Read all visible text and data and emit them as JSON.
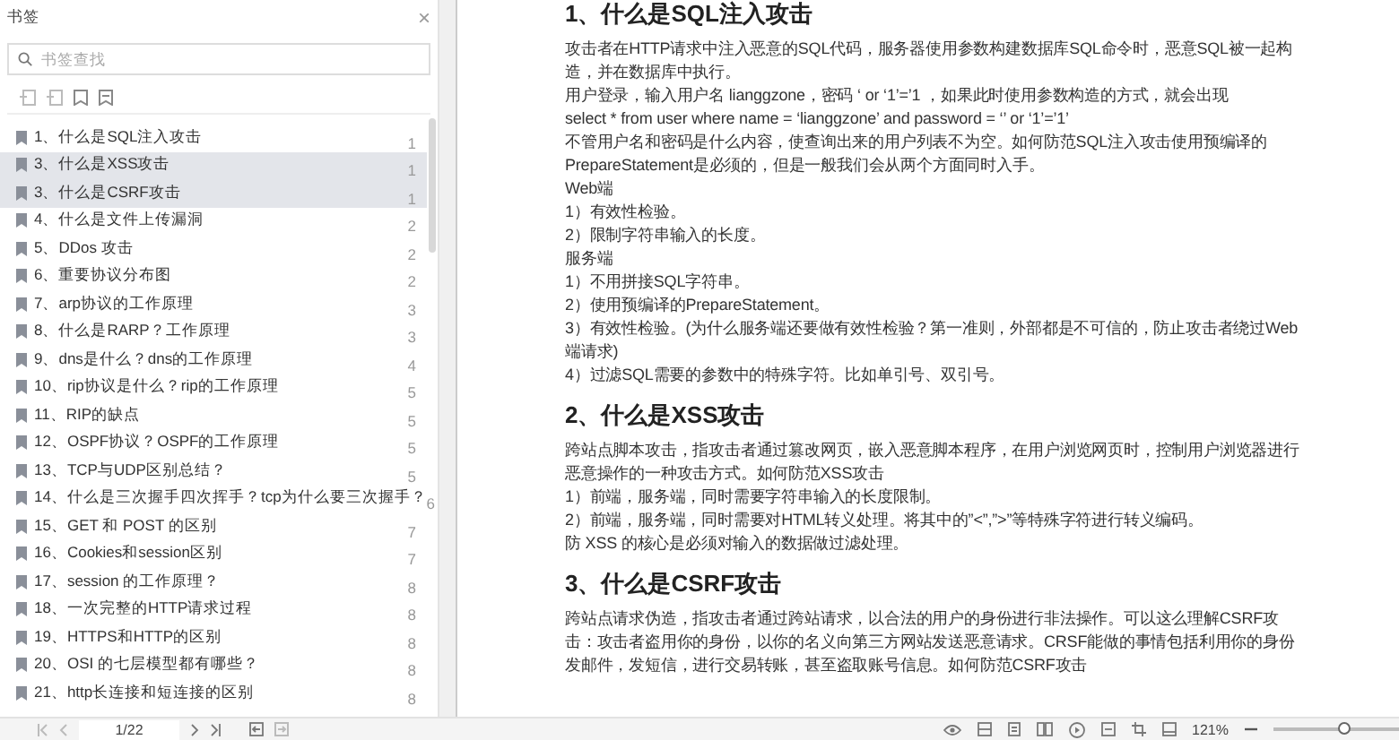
{
  "sidebar": {
    "title": "书签",
    "close": "×",
    "search": {
      "placeholder": "书签查找"
    },
    "bookmarks": [
      {
        "label": "1、什么是SQL注入攻击",
        "page": "1",
        "selected": false
      },
      {
        "label": "3、什么是XSS攻击",
        "page": "1",
        "selected": true
      },
      {
        "label": "3、什么是CSRF攻击",
        "page": "1",
        "selected": true
      },
      {
        "label": "4、什么是文件上传漏洞",
        "page": "2",
        "selected": false
      },
      {
        "label": "5、DDos 攻击",
        "page": "2",
        "selected": false
      },
      {
        "label": "6、重要协议分布图",
        "page": "2",
        "selected": false
      },
      {
        "label": "7、arp协议的工作原理",
        "page": "3",
        "selected": false
      },
      {
        "label": "8、什么是RARP？工作原理",
        "page": "3",
        "selected": false
      },
      {
        "label": "9、dns是什么？dns的工作原理",
        "page": "4",
        "selected": false
      },
      {
        "label": "10、rip协议是什么？rip的工作原理",
        "page": "5",
        "selected": false
      },
      {
        "label": "11、RIP的缺点",
        "page": "5",
        "selected": false
      },
      {
        "label": "12、OSPF协议？OSPF的工作原理",
        "page": "5",
        "selected": false
      },
      {
        "label": "13、TCP与UDP区别总结？",
        "page": "5",
        "selected": false
      },
      {
        "label": "14、什么是三次握手四次挥手？tcp为什么要三次握手？",
        "page": "6",
        "selected": false
      },
      {
        "label": "15、GET 和 POST 的区别",
        "page": "7",
        "selected": false
      },
      {
        "label": "16、Cookies和session区别",
        "page": "7",
        "selected": false
      },
      {
        "label": "17、session 的工作原理？",
        "page": "8",
        "selected": false
      },
      {
        "label": "18、一次完整的HTTP请求过程",
        "page": "8",
        "selected": false
      },
      {
        "label": "19、HTTPS和HTTP的区别",
        "page": "8",
        "selected": false
      },
      {
        "label": "20、OSI 的七层模型都有哪些？",
        "page": "8",
        "selected": false
      },
      {
        "label": "21、http长连接和短连接的区别",
        "page": "8",
        "selected": false
      }
    ]
  },
  "pager": {
    "page": "1/22"
  },
  "document": {
    "blocks": [
      {
        "kind": "heading",
        "text": "1、什么是SQL注入攻击"
      },
      {
        "kind": "para",
        "text": "攻击者在HTTP请求中注入恶意的SQL代码，服务器使用参数构建数据库SQL命令时，恶意SQL被一起构造，并在数据库中执行。"
      },
      {
        "kind": "para",
        "text": "用户登录，输入用户名 lianggzone，密码 ‘ or ‘1’=’1 ，如果此时使用参数构造的方式，就会出现"
      },
      {
        "kind": "para",
        "text": "select * from user where name = ‘lianggzone’ and password = ‘’ or ‘1’=’1’"
      },
      {
        "kind": "para",
        "text": "不管用户名和密码是什么内容，使查询出来的用户列表不为空。如何防范SQL注入攻击使用预编译的PrepareStatement是必须的，但是一般我们会从两个方面同时入手。"
      },
      {
        "kind": "para",
        "text": "Web端"
      },
      {
        "kind": "para",
        "text": "1）有效性检验。"
      },
      {
        "kind": "para",
        "text": "2）限制字符串输入的长度。"
      },
      {
        "kind": "para",
        "text": "服务端"
      },
      {
        "kind": "para",
        "text": "1）不用拼接SQL字符串。"
      },
      {
        "kind": "para",
        "text": "2）使用预编译的PrepareStatement。"
      },
      {
        "kind": "para",
        "text": "3）有效性检验。(为什么服务端还要做有效性检验？第一准则，外部都是不可信的，防止攻击者绕过Web端请求)"
      },
      {
        "kind": "para",
        "text": "4）过滤SQL需要的参数中的特殊字符。比如单引号、双引号。"
      },
      {
        "kind": "heading",
        "text": "2、什么是XSS攻击"
      },
      {
        "kind": "para",
        "text": "跨站点脚本攻击，指攻击者通过篡改网页，嵌入恶意脚本程序，在用户浏览网页时，控制用户浏览器进行恶意操作的一种攻击方式。如何防范XSS攻击"
      },
      {
        "kind": "para",
        "text": "1）前端，服务端，同时需要字符串输入的长度限制。"
      },
      {
        "kind": "para",
        "text": "2）前端，服务端，同时需要对HTML转义处理。将其中的”<”,”>”等特殊字符进行转义编码。"
      },
      {
        "kind": "para",
        "text": "防 XSS 的核心是必须对输入的数据做过滤处理。"
      },
      {
        "kind": "heading",
        "text": "3、什么是CSRF攻击"
      },
      {
        "kind": "para",
        "text": "跨站点请求伪造，指攻击者通过跨站请求，以合法的用户的身份进行非法操作。可以这么理解CSRF攻击：攻击者盗用你的身份，以你的名义向第三方网站发送恶意请求。CRSF能做的事情包括利用你的身份发邮件，发短信，进行交易转账，甚至盗取账号信息。如何防范CSRF攻击"
      }
    ]
  },
  "zoom": {
    "reading": "121%",
    "level": 0.57
  }
}
